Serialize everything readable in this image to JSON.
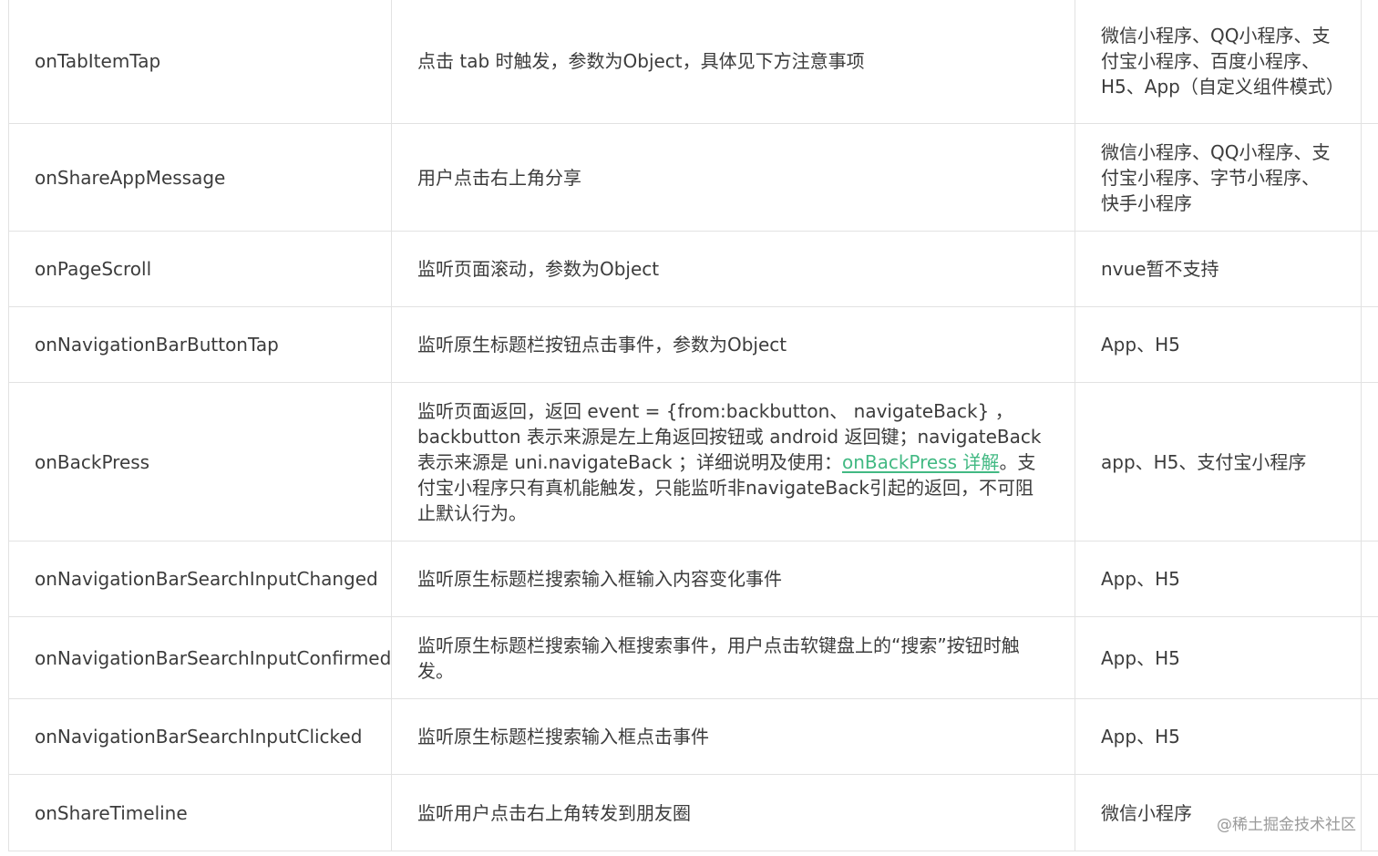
{
  "rows": [
    {
      "name": "onTabItemTap",
      "description": "点击 tab 时触发，参数为Object，具体见下方注意事项",
      "platform": "微信小程序、QQ小程序、支付宝小程序、百度小程序、H5、App（自定义组件模式）"
    },
    {
      "name": "onShareAppMessage",
      "description": "用户点击右上角分享",
      "platform": "微信小程序、QQ小程序、支付宝小程序、字节小程序、快手小程序"
    },
    {
      "name": "onPageScroll",
      "description": "监听页面滚动，参数为Object",
      "platform": "nvue暂不支持"
    },
    {
      "name": "onNavigationBarButtonTap",
      "description": "监听原生标题栏按钮点击事件，参数为Object",
      "platform": "App、H5"
    },
    {
      "name": "onBackPress",
      "description_before": "监听页面返回，返回 event = {from:backbutton、 navigateBack} ，backbutton 表示来源是左上角返回按钮或 android 返回键；navigateBack表示来源是 uni.navigateBack ；详细说明及使用：",
      "description_link": "onBackPress 详解",
      "description_after": "。支付宝小程序只有真机能触发，只能监听非navigateBack引起的返回，不可阻止默认行为。",
      "platform": "app、H5、支付宝小程序"
    },
    {
      "name": "onNavigationBarSearchInputChanged",
      "description": "监听原生标题栏搜索输入框输入内容变化事件",
      "platform": "App、H5"
    },
    {
      "name": "onNavigationBarSearchInputConfirmed",
      "description": "监听原生标题栏搜索输入框搜索事件，用户点击软键盘上的“搜索”按钮时触发。",
      "platform": "App、H5"
    },
    {
      "name": "onNavigationBarSearchInputClicked",
      "description": "监听原生标题栏搜索输入框点击事件",
      "platform": "App、H5"
    },
    {
      "name": "onShareTimeline",
      "description": "监听用户点击右上角转发到朋友圈",
      "platform": "微信小程序"
    }
  ],
  "watermark": "@稀土掘金技术社区",
  "colors": {
    "text": "#3c3c3c",
    "link": "#42b983",
    "border": "#e2e2e2",
    "watermark": "#9a9a9a"
  }
}
